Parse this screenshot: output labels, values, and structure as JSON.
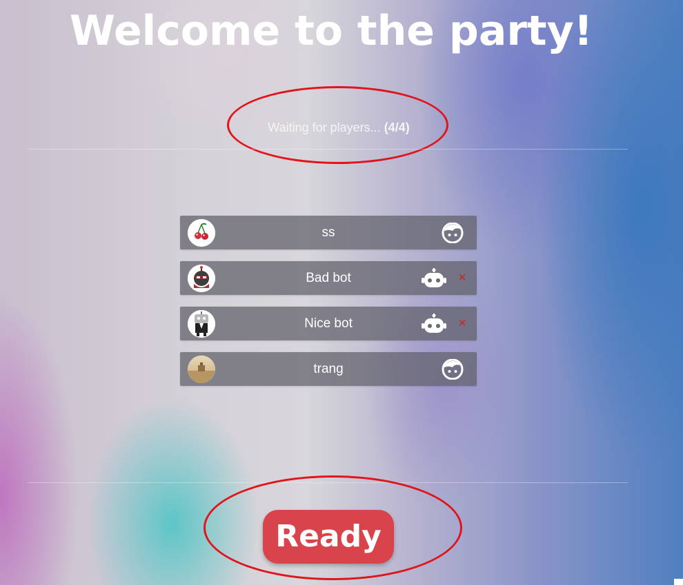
{
  "page": {
    "title": "Welcome to the party!"
  },
  "status": {
    "waiting_text": "Waiting for players...",
    "count_text": "(4/4)"
  },
  "players": [
    {
      "name": "ss",
      "type": "human",
      "avatar": "cherries-avatar",
      "removable": false
    },
    {
      "name": "Bad bot",
      "type": "bot",
      "avatar": "dark-ninja-avatar",
      "removable": true
    },
    {
      "name": "Nice bot",
      "type": "bot",
      "avatar": "suited-robot-avatar",
      "removable": true
    },
    {
      "name": "trang",
      "type": "human",
      "avatar": "landscape-photo-avatar",
      "removable": false
    }
  ],
  "remove_label": "×",
  "ready_button": {
    "label": "Ready"
  },
  "colors": {
    "ready_bg": "#d9434c",
    "remove_x": "#d81818",
    "annotation_circle": "#e0141b",
    "row_bg": "#5f5f69"
  }
}
